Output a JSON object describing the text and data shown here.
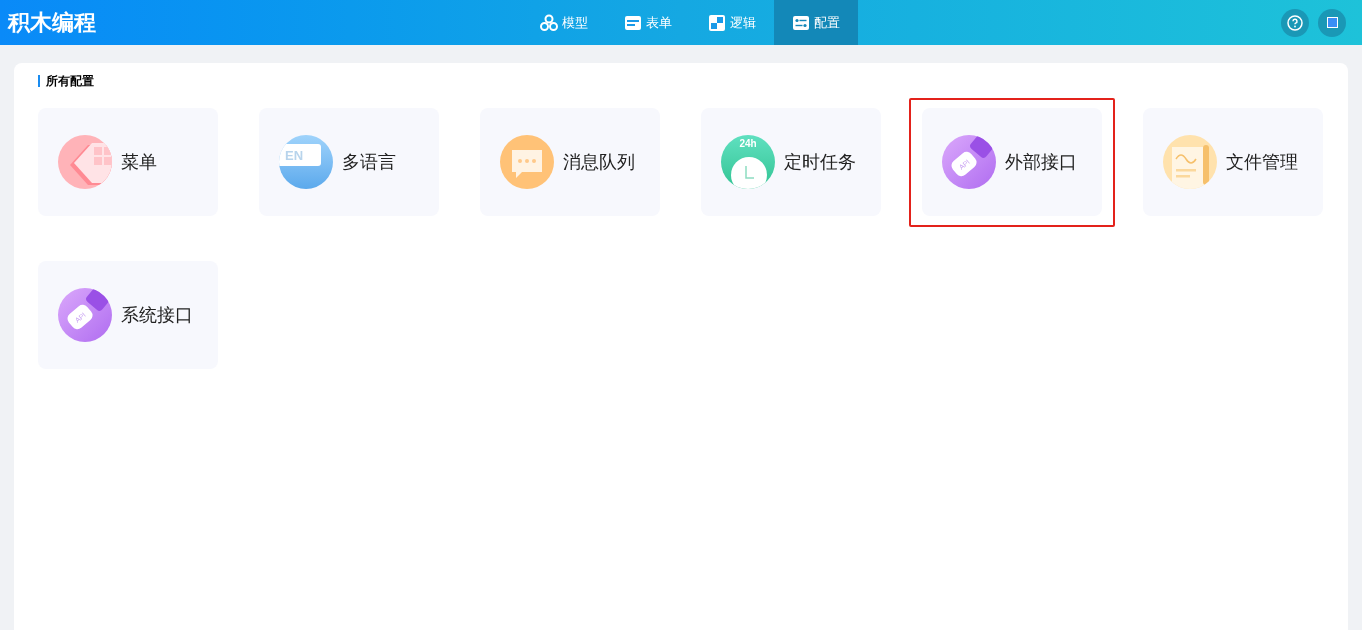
{
  "app": {
    "title": "积木编程"
  },
  "nav": [
    {
      "label": "模型",
      "kind": "model",
      "selected": false
    },
    {
      "label": "表单",
      "kind": "form",
      "selected": false
    },
    {
      "label": "逻辑",
      "kind": "logic",
      "selected": false
    },
    {
      "label": "配置",
      "kind": "config",
      "selected": true
    }
  ],
  "section": {
    "title": "所有配置"
  },
  "items": [
    {
      "label": "菜单",
      "kind": "menu",
      "highlighted": false
    },
    {
      "label": "多语言",
      "kind": "language",
      "icon_text": "EN",
      "highlighted": false
    },
    {
      "label": "消息队列",
      "kind": "message",
      "highlighted": false
    },
    {
      "label": "定时任务",
      "kind": "timer",
      "icon_text": "24h",
      "highlighted": false
    },
    {
      "label": "外部接口",
      "kind": "plug",
      "icon_text": "API",
      "highlighted": true
    },
    {
      "label": "文件管理",
      "kind": "file",
      "highlighted": false
    },
    {
      "label": "系统接口",
      "kind": "plug",
      "icon_text": "API",
      "highlighted": false
    }
  ]
}
